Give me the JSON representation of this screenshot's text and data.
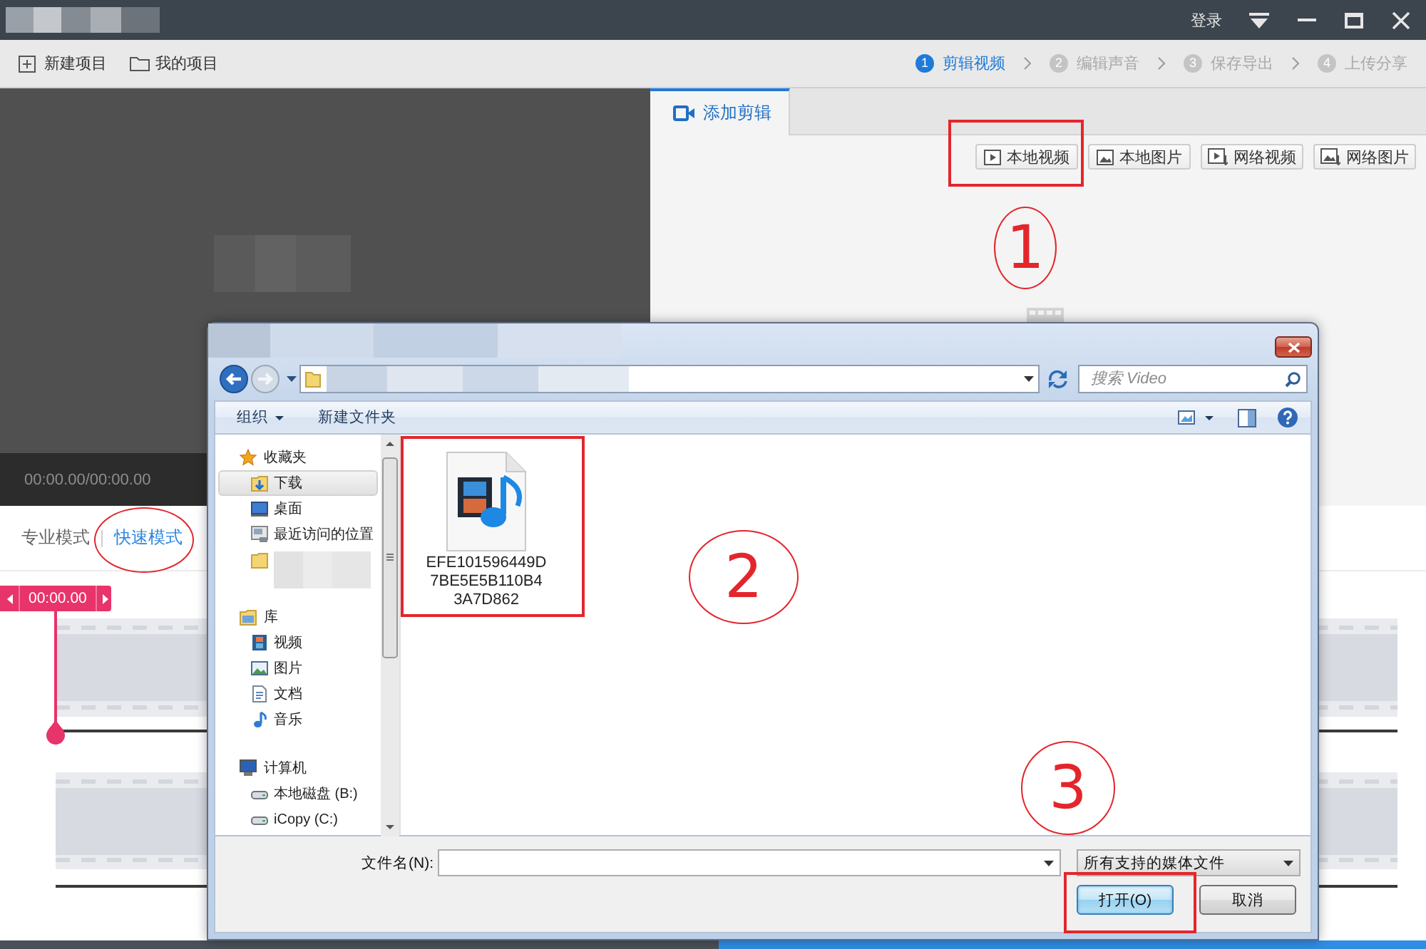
{
  "title_bar": {
    "login": "登录"
  },
  "toolbar": {
    "actions": [
      "新建项目",
      "我的项目"
    ],
    "steps": [
      {
        "number": "1",
        "label": "剪辑视频",
        "selected": true
      },
      {
        "number": "2",
        "label": "编辑声音",
        "selected": false
      },
      {
        "number": "3",
        "label": "保存导出",
        "selected": false
      },
      {
        "number": "4",
        "label": "上传分享",
        "selected": false
      }
    ]
  },
  "preview": {
    "time": "00:00.00/00:00.00"
  },
  "clip_panel": {
    "tabs": [
      {
        "label": "添加剪辑",
        "selected": true
      }
    ],
    "buttons": [
      "本地视频",
      "本地图片",
      "网络视频",
      "网络图片"
    ]
  },
  "modes": [
    {
      "label": "专业模式",
      "selected": false
    },
    {
      "label": "快速模式",
      "selected": true
    }
  ],
  "timeline": {
    "playhead_time": "00:00.00"
  },
  "file_dialog": {
    "search": {
      "placeholder": "搜索 Video"
    },
    "commands": [
      {
        "label": "组织",
        "kind": "menu"
      },
      {
        "label": "新建文件夹",
        "kind": "button"
      }
    ],
    "nav": [
      {
        "label": "收藏夹",
        "selected": false,
        "children": [
          {
            "kind": "link",
            "label": "下载",
            "selected": true
          },
          {
            "kind": "link",
            "label": "桌面",
            "selected": false
          },
          {
            "kind": "link",
            "label": "最近访问的位置",
            "selected": false
          },
          {
            "kind": "redacted",
            "selected": false
          }
        ]
      },
      {
        "label": "库",
        "selected": false,
        "children": [
          {
            "kind": "link",
            "label": "视频",
            "selected": false
          },
          {
            "kind": "link",
            "label": "图片",
            "selected": false
          },
          {
            "kind": "link",
            "label": "文档",
            "selected": false
          },
          {
            "kind": "link",
            "label": "音乐",
            "selected": false
          }
        ]
      },
      {
        "label": "计算机",
        "selected": false,
        "children": [
          {
            "kind": "link",
            "label": "本地磁盘 (B:)",
            "selected": false
          },
          {
            "kind": "link",
            "label": "iCopy (C:)",
            "selected": false
          }
        ]
      }
    ],
    "files": [
      {
        "name": "EFE101596449D7BE5E5B110B43A7D862",
        "selected": false
      }
    ],
    "file_name": {
      "label": "文件名(N):"
    },
    "file_type": {
      "value": "所有支持的媒体文件"
    },
    "buttons": [
      {
        "label": "打开(O)",
        "default": true
      },
      {
        "label": "取消",
        "default": false
      }
    ]
  },
  "annotations": [
    {
      "kind": "box"
    },
    {
      "kind": "number",
      "label": "1"
    },
    {
      "kind": "ellipse"
    },
    {
      "kind": "box"
    },
    {
      "kind": "number",
      "label": "2"
    },
    {
      "kind": "number",
      "label": "3"
    },
    {
      "kind": "box"
    }
  ]
}
